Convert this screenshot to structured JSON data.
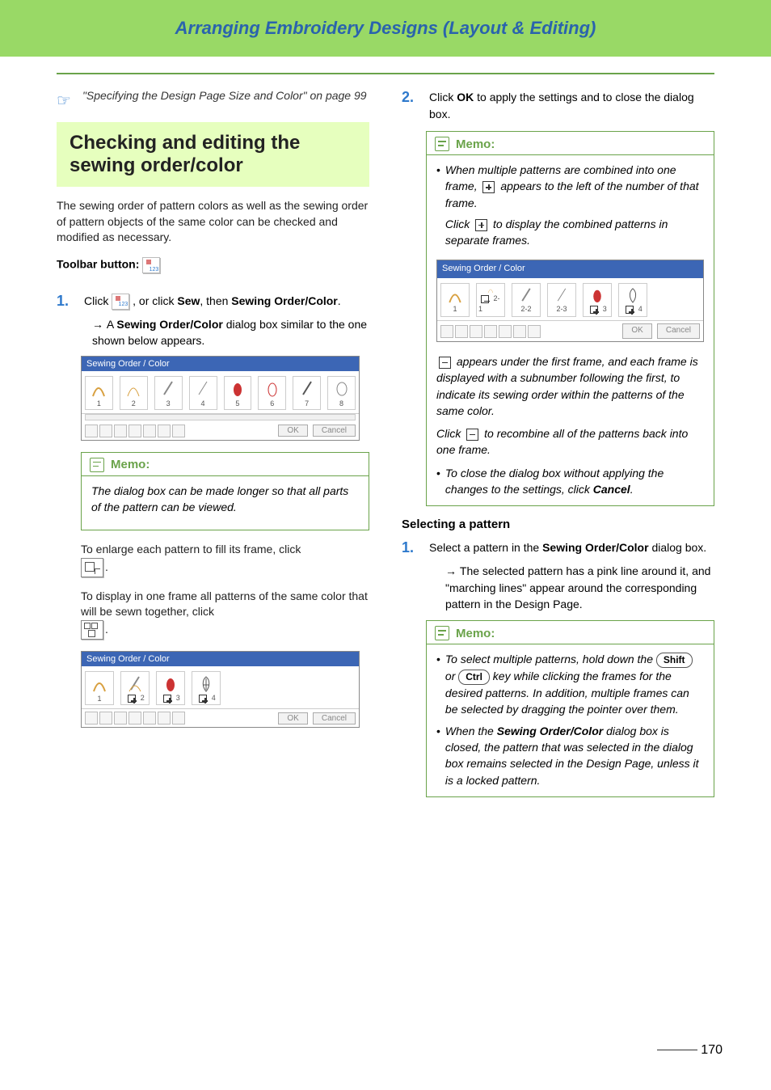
{
  "header": {
    "title": "Arranging Embroidery Designs (Layout & Editing)"
  },
  "ref": {
    "text": "\"Specifying the Design Page Size and Color\" on page 99"
  },
  "section_heading": "Checking and editing the sewing order/color",
  "intro": "The sewing order of pattern colors as well as the sewing order of pattern objects of the same color can be checked and modified as necessary.",
  "toolbar_label": "Toolbar button:",
  "step1": {
    "num": "1.",
    "pre": "Click ",
    "post": " , or click ",
    "b1": "Sew",
    "mid": ", then ",
    "b2": "Sewing Order/Color",
    "end": ".",
    "result_pre": "A ",
    "result_b": "Sewing Order/Color",
    "result_post": " dialog box similar to the one shown below appears."
  },
  "dlg1": {
    "title": "Sewing Order / Color",
    "ok": "OK",
    "cancel": "Cancel",
    "nums": [
      "1",
      "2",
      "3",
      "4",
      "5",
      "6",
      "7",
      "8"
    ]
  },
  "memo1": {
    "title": "Memo:",
    "text": "The dialog box can be made longer so that all parts of the pattern can be viewed."
  },
  "text_enlarge": "To enlarge each pattern to fill its frame, click ",
  "text_combine": "To display in one frame all patterns of the same color that will be sewn together, click ",
  "dlg2": {
    "title": "Sewing Order / Color",
    "ok": "OK",
    "cancel": "Cancel",
    "nums": [
      "1",
      "2",
      "3",
      "4"
    ]
  },
  "step2": {
    "num": "2.",
    "pre": "Click ",
    "b": "OK",
    "post": " to apply the settings and to close the dialog box."
  },
  "memo2": {
    "title": "Memo:",
    "b1_pre": "When multiple patterns are combined into one frame, ",
    "b1_post": " appears to the left of the number of that frame.",
    "b1b_pre": "Click ",
    "b1b_post": " to display the combined patterns in separate frames.",
    "dlg": {
      "title": "Sewing Order / Color",
      "ok": "OK",
      "cancel": "Cancel",
      "nums": [
        "1",
        "2-1",
        "2-2",
        "2-3",
        "3",
        "4"
      ]
    },
    "p2_post": " appears under the first frame, and each frame is displayed with a subnumber following the first, to indicate its sewing order within the patterns of the same color.",
    "p3_pre": "Click ",
    "p3_post": " to recombine all of the patterns back into one frame.",
    "b2_pre": "To close the dialog box without applying the changes to the settings, click ",
    "b2_b": "Cancel",
    "b2_post": "."
  },
  "subheading": "Selecting a pattern",
  "step3": {
    "num": "1.",
    "pre": "Select a pattern in the ",
    "b": "Sewing Order/Color",
    "post": " dialog box.",
    "result": "The selected pattern has a pink line around it, and \"marching lines\" appear around the corresponding pattern in the Design Page."
  },
  "memo3": {
    "title": "Memo:",
    "b1_pre": "To select multiple patterns, hold down the ",
    "key1": "Shift",
    "or": " or ",
    "key2": "Ctrl",
    "b1_post": " key while clicking the frames for the desired patterns. In addition, multiple frames can be selected by dragging the pointer over them.",
    "b2_pre": "When the ",
    "b2_b": "Sewing Order/Color",
    "b2_post": " dialog box is closed, the pattern that was selected in the dialog box remains selected in the Design Page, unless it is a locked pattern."
  },
  "page_num": "170"
}
